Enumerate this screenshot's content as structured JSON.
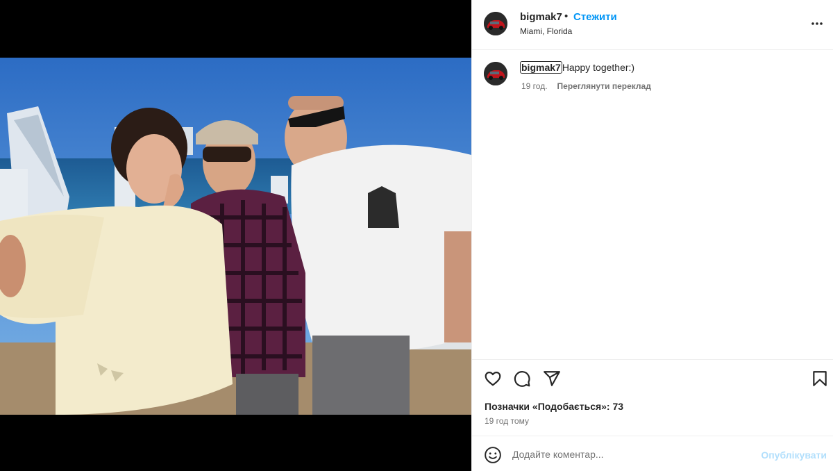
{
  "post": {
    "username": "bigmak7",
    "follow_label": "Стежити",
    "dot": "•",
    "location": "Miami, Florida",
    "caption_user": "bigmak7",
    "caption_text": "Happy together:)",
    "caption_time": "19 год.",
    "translate_label": "Переглянути переклад",
    "likes_text": "Позначки «Подобається»: 73",
    "time_ago": "19 год тому"
  },
  "comment": {
    "placeholder": "Додайте коментар...",
    "publish_label": "Опублікувати"
  },
  "colors": {
    "accent": "#0095f6",
    "publish_disabled": "#b2dffc",
    "text": "#262626",
    "muted": "#737373",
    "border": "#efefef"
  },
  "icons": [
    "more-icon",
    "heart-icon",
    "comment-icon",
    "share-icon",
    "bookmark-icon",
    "emoji-icon"
  ]
}
